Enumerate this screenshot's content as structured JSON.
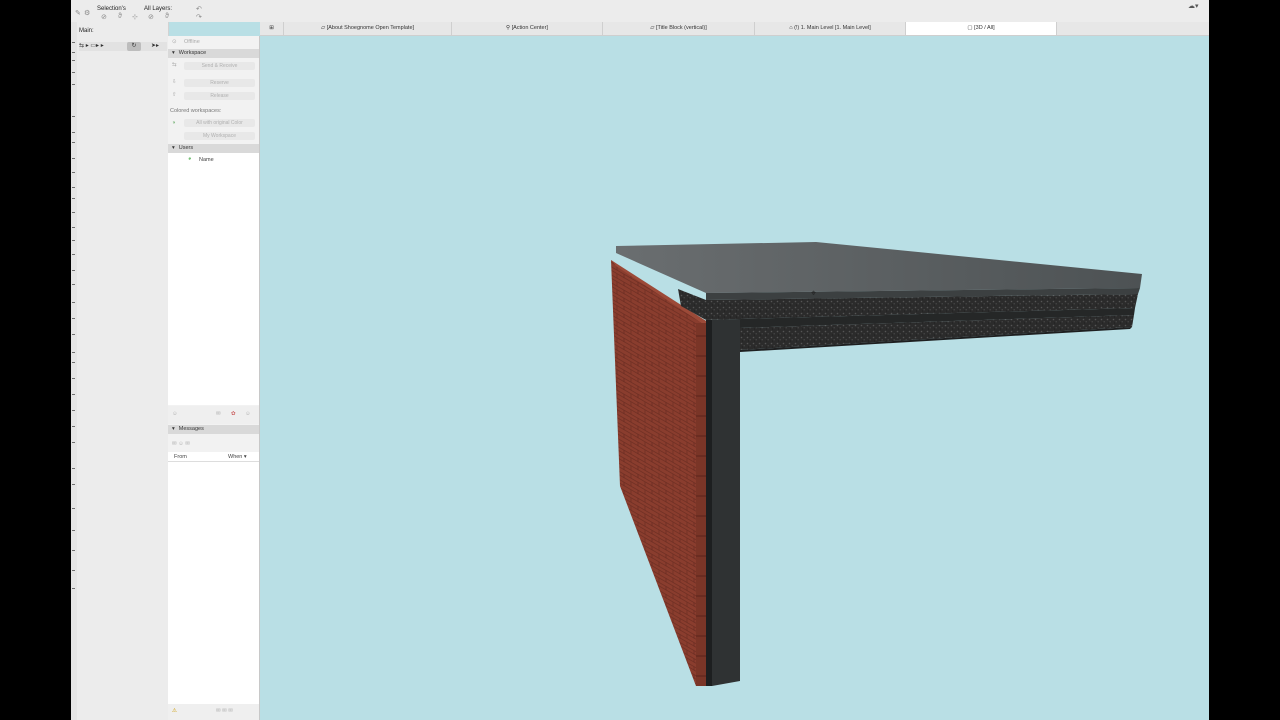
{
  "toolbar": {
    "selections_label": "Selection's",
    "layers_label": "All Layers:",
    "main_label": "Main:"
  },
  "teamwork": {
    "status": "Offline",
    "workspace_header": "Workspace",
    "send_receive": "Send & Receive",
    "reserve": "Reserve",
    "release": "Release",
    "colored_workspaces_label": "Colored workspaces:",
    "color_mode": "All with original Color",
    "my_workspace": "My Workspace",
    "users_header": "Users",
    "users_column": "Name",
    "messages_header": "Messages",
    "messages_col_from": "From",
    "messages_col_when": "When ▾"
  },
  "tabs": [
    {
      "label": "[About Shoegnome Open Template]"
    },
    {
      "label": "[Action Center]"
    },
    {
      "label": "[Title Block (vertical)]"
    },
    {
      "label": "(!) 1. Main Level [1. Main Level]"
    },
    {
      "label": "[3D / All]"
    }
  ],
  "colors": {
    "viewport_bg": "#b9dfe5",
    "brick": "#8a3d2e",
    "slab_top": "#5f6364",
    "insulation": "#2a2a2a"
  }
}
